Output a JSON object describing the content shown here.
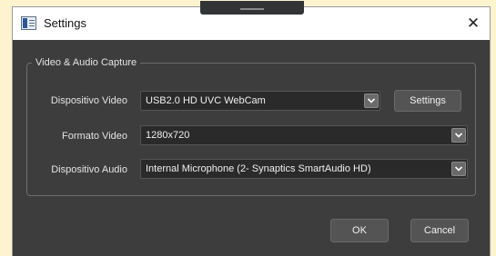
{
  "window": {
    "title": "Settings",
    "close_glyph": "✕"
  },
  "group": {
    "legend": "Video & Audio Capture"
  },
  "video_device": {
    "label": "Dispositivo Video",
    "value": "USB2.0 HD UVC WebCam",
    "settings_button": "Settings"
  },
  "video_format": {
    "label": "Formato Video",
    "value": "1280x720"
  },
  "audio_device": {
    "label": "Dispositivo Audio",
    "value": "Internal Microphone (2- Synaptics SmartAudio HD)"
  },
  "footer": {
    "ok_label": "OK",
    "cancel_label": "Cancel"
  },
  "colors": {
    "dialog_bg": "#3d3d3d",
    "titlebar_bg": "#ffffff",
    "combo_bg": "#2a2a2a",
    "button_bg": "#545454",
    "page_bg": "#fdf3cf"
  },
  "icons": {
    "app": "settings-app-icon",
    "close": "close-icon",
    "dropdown": "chevron-down-icon"
  }
}
